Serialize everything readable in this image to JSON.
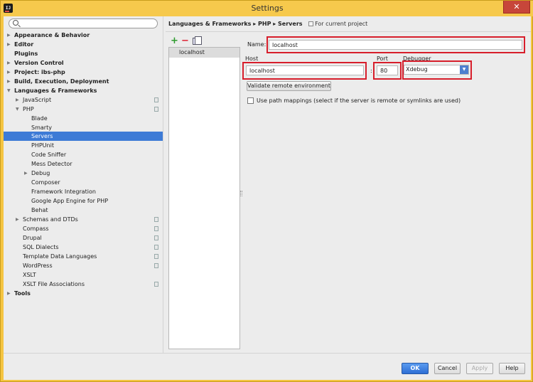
{
  "window": {
    "title": "Settings",
    "close_symbol": "✕",
    "app_icon": "intellij-app-icon",
    "app_icon_text": "IJ"
  },
  "search": {
    "placeholder": "",
    "value": ""
  },
  "sidebar": {
    "items": [
      {
        "label": "Appearance & Behavior",
        "bold": true,
        "arrow": "right"
      },
      {
        "label": "Editor",
        "bold": true,
        "arrow": "right"
      },
      {
        "label": "Plugins",
        "bold": true,
        "arrow": ""
      },
      {
        "label": "Version Control",
        "bold": true,
        "arrow": "right"
      },
      {
        "label": "Project: ibs-php",
        "bold": true,
        "arrow": "right"
      },
      {
        "label": "Build, Execution, Deployment",
        "bold": true,
        "arrow": "right"
      },
      {
        "label": "Languages & Frameworks",
        "bold": true,
        "arrow": "down"
      },
      {
        "label": "JavaScript",
        "bold": false,
        "arrow": "right",
        "cfg": true
      },
      {
        "label": "PHP",
        "bold": false,
        "arrow": "down",
        "cfg": true
      },
      {
        "label": "Blade",
        "bold": false,
        "arrow": ""
      },
      {
        "label": "Smarty",
        "bold": false,
        "arrow": ""
      },
      {
        "label": "Servers",
        "bold": false,
        "arrow": "",
        "selected": true
      },
      {
        "label": "PHPUnit",
        "bold": false,
        "arrow": ""
      },
      {
        "label": "Code Sniffer",
        "bold": false,
        "arrow": ""
      },
      {
        "label": "Mess Detector",
        "bold": false,
        "arrow": ""
      },
      {
        "label": "Debug",
        "bold": false,
        "arrow": "right"
      },
      {
        "label": "Composer",
        "bold": false,
        "arrow": ""
      },
      {
        "label": "Framework Integration",
        "bold": false,
        "arrow": ""
      },
      {
        "label": "Google App Engine for PHP",
        "bold": false,
        "arrow": ""
      },
      {
        "label": "Behat",
        "bold": false,
        "arrow": ""
      },
      {
        "label": "Schemas and DTDs",
        "bold": false,
        "arrow": "right",
        "cfg": true
      },
      {
        "label": "Compass",
        "bold": false,
        "arrow": "",
        "cfg": true
      },
      {
        "label": "Drupal",
        "bold": false,
        "arrow": "",
        "cfg": true
      },
      {
        "label": "SQL Dialects",
        "bold": false,
        "arrow": "",
        "cfg": true
      },
      {
        "label": "Template Data Languages",
        "bold": false,
        "arrow": "",
        "cfg": true
      },
      {
        "label": "WordPress",
        "bold": false,
        "arrow": "",
        "cfg": true
      },
      {
        "label": "XSLT",
        "bold": false,
        "arrow": ""
      },
      {
        "label": "XSLT File Associations",
        "bold": false,
        "arrow": "",
        "cfg": true
      },
      {
        "label": "Tools",
        "bold": true,
        "arrow": "right"
      }
    ]
  },
  "header": {
    "breadcrumb": "Languages & Frameworks ▸ PHP ▸ Servers",
    "scope": "For current project"
  },
  "toolbar": {
    "add": "+",
    "remove": "−"
  },
  "servers": {
    "items": [
      "localhost"
    ]
  },
  "form": {
    "name_label": "Name:",
    "name_value": "localhost",
    "host_label": "Host",
    "host_value": "localhost",
    "port_label": "Port",
    "port_value": "80",
    "port_separator": ":",
    "debugger_label": "Debugger",
    "debugger_value": "Xdebug",
    "validate_button": "Validate remote environment",
    "path_mappings_label": "Use path mappings (select if the server is remote or symlinks are used)",
    "path_mappings_checked": false
  },
  "buttons": {
    "ok": "OK",
    "cancel": "Cancel",
    "apply": "Apply",
    "help": "Help"
  },
  "colors": {
    "accent": "#3e7bd6",
    "highlight": "#d71e2b",
    "titlebar": "#f6c94c"
  }
}
